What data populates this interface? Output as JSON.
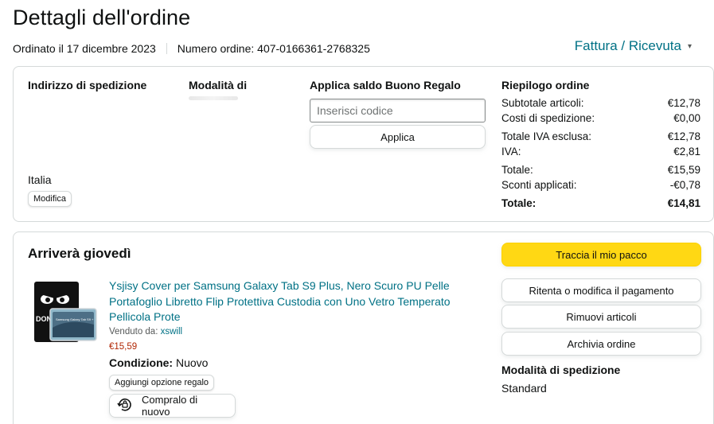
{
  "header": {
    "title": "Dettagli dell'ordine",
    "ordered_on": "Ordinato il 17 dicembre 2023",
    "order_number": "Numero ordine: 407-0166361-2768325",
    "invoice_link": "Fattura / Ricevuta"
  },
  "summary": {
    "shipping_address_heading": "Indirizzo di spedizione",
    "country": "Italia",
    "edit_label": "Modifica",
    "payment_heading": "Modalità di",
    "gift": {
      "heading": "Applica saldo Buono Regalo",
      "placeholder": "Inserisci codice",
      "apply_label": "Applica"
    },
    "order_summary": {
      "heading": "Riepilogo ordine",
      "rows": [
        {
          "label": "Subtotale articoli:",
          "value": "€12,78"
        },
        {
          "label": "Costi di spedizione:",
          "value": "€0,00"
        },
        {
          "label": "Totale IVA esclusa:",
          "value": "€12,78"
        },
        {
          "label": "IVA:",
          "value": "€2,81"
        },
        {
          "label": "Totale:",
          "value": "€15,59"
        },
        {
          "label": "Sconti applicati:",
          "value": "-€0,78"
        }
      ],
      "grand_total": {
        "label": "Totale:",
        "value": "€14,81"
      }
    }
  },
  "shipment": {
    "arrival": "Arriverà giovedì",
    "product": {
      "title": "Ysjisy Cover per Samsung Galaxy Tab S9 Plus, Nero Scuro PU Pelle Portafoglio Libretto Flip Protettiva Custodia con Uno Vetro Temperato Pellicola Prote",
      "sold_by_label": "Venduto da:",
      "seller": "xswill",
      "price": "€15,59",
      "condition_label": "Condizione:",
      "condition_value": "Nuovo",
      "gift_option_label": "Aggiungi opzione regalo",
      "buy_again_label": "Compralo di nuovo",
      "image_text": "DON",
      "image_device_text": "Samsung Galaxy Tab S9 +"
    },
    "actions": {
      "track": "Traccia il mio pacco",
      "retry_payment": "Ritenta o modifica il pagamento",
      "remove_items": "Rimuovi articoli",
      "archive": "Archivia ordine"
    },
    "shipping_mode_heading": "Modalità di spedizione",
    "shipping_mode_value": "Standard"
  },
  "colors": {
    "link": "#007185",
    "price": "#b12704",
    "primary_button": "#ffd814",
    "border": "#d5d9d9"
  }
}
